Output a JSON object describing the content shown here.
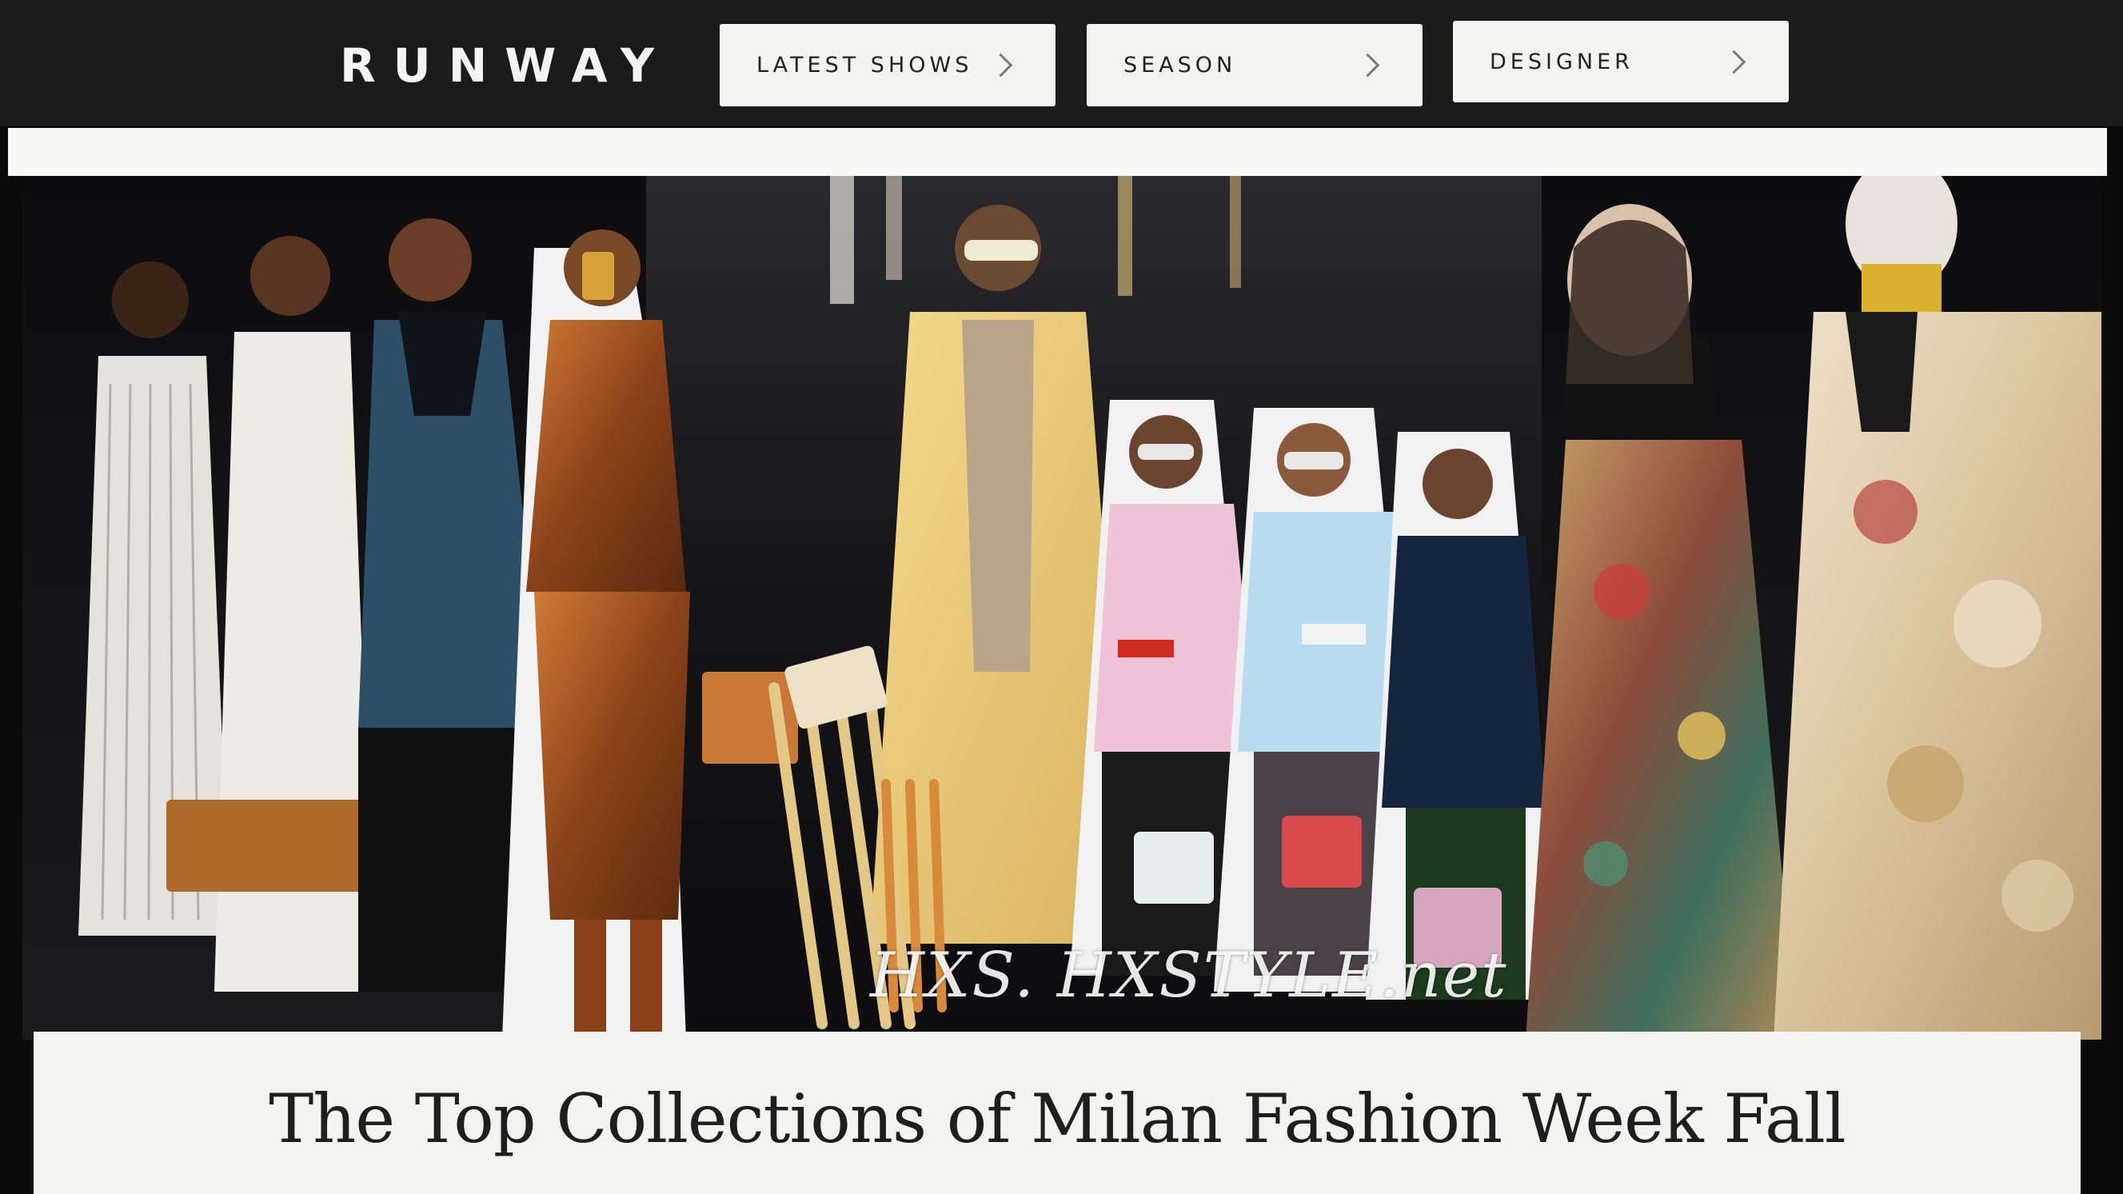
{
  "header": {
    "logo": "RUNWAY",
    "nav": [
      {
        "label": "LATEST SHOWS",
        "icon": "chevron-right-icon"
      },
      {
        "label": "SEASON",
        "icon": "chevron-right-icon"
      },
      {
        "label": "DESIGNER",
        "icon": "chevron-right-icon"
      }
    ]
  },
  "hero": {
    "watermark": "HXS. HXSTYLE.net",
    "headline": "The Top Collections of Milan Fashion Week Fall"
  },
  "colors": {
    "topbar": "#1b1b1c",
    "nav_button": "#f3f3f1",
    "page_background": "#0b0b0c",
    "headline_card": "#f3f3f2"
  }
}
